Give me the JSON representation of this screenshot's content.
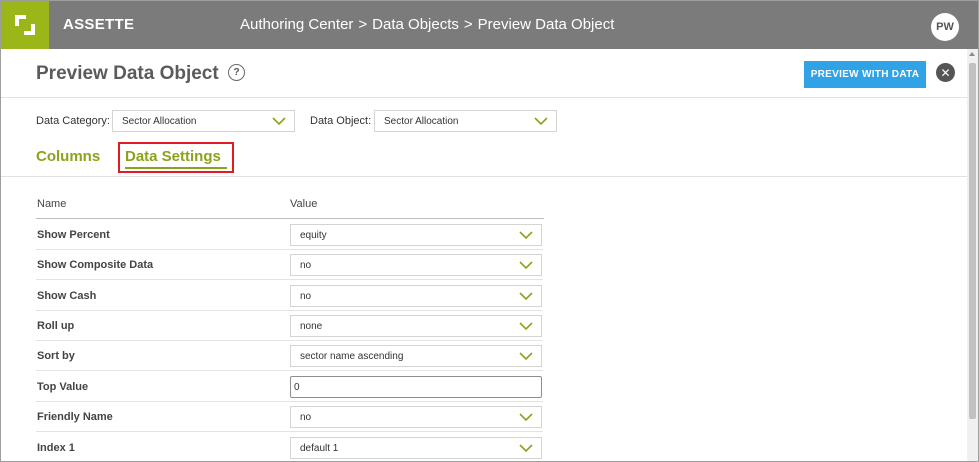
{
  "app": {
    "brand": "ASSETTE",
    "breadcrumb": [
      "Authoring Center",
      "Data Objects",
      "Preview Data Object"
    ],
    "breadcrumb_separator": ">",
    "user_initials": "PW",
    "brand_color": "#9ab619",
    "accent_color": "#2fa3e6"
  },
  "header": {
    "title": "Preview Data Object",
    "help_label": "?",
    "preview_button": "PREVIEW WITH DATA",
    "close_label": "✕"
  },
  "filters": {
    "category_label": "Data Category:",
    "category_value": "Sector Allocation",
    "object_label": "Data Object:",
    "object_value": "Sector Allocation"
  },
  "tabs": [
    {
      "label": "Columns",
      "active": false
    },
    {
      "label": "Data Settings",
      "active": true
    }
  ],
  "settings": {
    "col_name": "Name",
    "col_value": "Value",
    "rows": [
      {
        "name": "Show Percent",
        "value": "equity",
        "type": "select"
      },
      {
        "name": "Show Composite Data",
        "value": "no",
        "type": "select"
      },
      {
        "name": "Show Cash",
        "value": "no",
        "type": "select"
      },
      {
        "name": "Roll up",
        "value": "none",
        "type": "select"
      },
      {
        "name": "Sort by",
        "value": "sector name ascending",
        "type": "select"
      },
      {
        "name": "Top Value",
        "value": "0",
        "type": "input"
      },
      {
        "name": "Friendly Name",
        "value": "no",
        "type": "select"
      },
      {
        "name": "Index 1",
        "value": "default 1",
        "type": "select"
      }
    ]
  }
}
